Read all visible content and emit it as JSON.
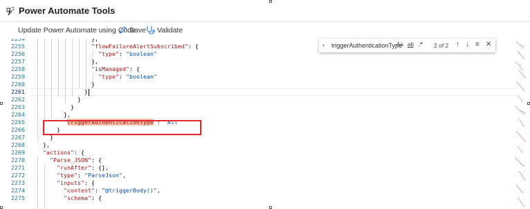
{
  "window": {
    "title": "Power Automate Tools",
    "icon": "power-automate-tools-icon"
  },
  "toolbar": {
    "update_label": "Update Power Automate using Code",
    "save_label": "Save",
    "validate_label": "Validate",
    "save_icon": "pencil-icon",
    "validate_icon": "stethoscope-icon"
  },
  "find_widget": {
    "query": "triggerAuthenticationType",
    "match_case": "Aa",
    "whole_word": "ab",
    "regex": ".*",
    "count": "2 of 2",
    "prev_icon": "arrow-up-icon",
    "next_icon": "arrow-down-icon",
    "selection_icon": "find-in-selection-icon",
    "close_icon": "close-icon"
  },
  "editor": {
    "line_numbers": [
      "2254",
      "2255",
      "2256",
      "2257",
      "2258",
      "2259",
      "2260",
      "2261",
      "2262",
      "2263",
      "2264",
      "2265",
      "2266",
      "2267",
      "2268",
      "2269",
      "2270",
      "2271",
      "2272",
      "2273",
      "2274",
      "2275"
    ],
    "active_line": "2261",
    "lines": [
      [
        {
          "t": "pun",
          "v": "},"
        }
      ],
      [
        {
          "t": "key",
          "v": "\"flowFailureAlertSubscribed\""
        },
        {
          "t": "pun",
          "v": ": {"
        }
      ],
      [
        {
          "t": "key",
          "v": "\"type\""
        },
        {
          "t": "pun",
          "v": ": "
        },
        {
          "t": "str",
          "v": "\"boolean\""
        }
      ],
      [
        {
          "t": "pun",
          "v": "},"
        }
      ],
      [
        {
          "t": "key",
          "v": "\"isManaged\""
        },
        {
          "t": "pun",
          "v": ": {"
        }
      ],
      [
        {
          "t": "key",
          "v": "\"type\""
        },
        {
          "t": "pun",
          "v": ": "
        },
        {
          "t": "str",
          "v": "\"boolean\""
        }
      ],
      [
        {
          "t": "pun",
          "v": "}"
        }
      ],
      [
        {
          "t": "pun",
          "v": "}"
        }
      ],
      [
        {
          "t": "pun",
          "v": "}"
        }
      ],
      [
        {
          "t": "pun",
          "v": "}"
        }
      ],
      [
        {
          "t": "pun",
          "v": "},"
        }
      ],
      [
        {
          "t": "pun",
          "v": "\""
        },
        {
          "t": "key hl",
          "v": "triggerAuthenticationType"
        },
        {
          "t": "pun",
          "v": "\": "
        },
        {
          "t": "str",
          "v": "\"All\""
        }
      ],
      [
        {
          "t": "pun",
          "v": "}"
        }
      ],
      [
        {
          "t": "pun",
          "v": "}"
        }
      ],
      [
        {
          "t": "pun",
          "v": "},"
        }
      ],
      [
        {
          "t": "key",
          "v": "\"actions\""
        },
        {
          "t": "pun",
          "v": ": {"
        }
      ],
      [
        {
          "t": "key",
          "v": "\"Parse_JSON\""
        },
        {
          "t": "pun",
          "v": ": {"
        }
      ],
      [
        {
          "t": "key",
          "v": "\"runAfter\""
        },
        {
          "t": "pun",
          "v": ": {},"
        }
      ],
      [
        {
          "t": "key",
          "v": "\"type\""
        },
        {
          "t": "pun",
          "v": ": "
        },
        {
          "t": "str",
          "v": "\"ParseJson\""
        },
        {
          "t": "pun",
          "v": ","
        }
      ],
      [
        {
          "t": "key",
          "v": "\"inputs\""
        },
        {
          "t": "pun",
          "v": ": {"
        }
      ],
      [
        {
          "t": "key",
          "v": "\"content\""
        },
        {
          "t": "pun",
          "v": ": "
        },
        {
          "t": "str",
          "v": "\"@triggerBody()\""
        },
        {
          "t": "pun",
          "v": ","
        }
      ],
      [
        {
          "t": "key",
          "v": "\"schema\""
        },
        {
          "t": "pun",
          "v": ": {"
        }
      ]
    ]
  }
}
